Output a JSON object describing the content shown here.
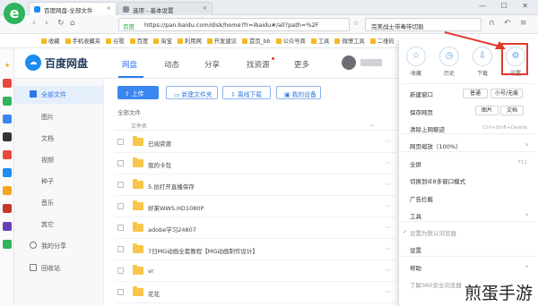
{
  "browser": {
    "logo": "e",
    "tabs": [
      {
        "label": "百度网盘-全部文件"
      },
      {
        "label": "选项 - 基本设置"
      }
    ],
    "address": {
      "secure_label": "百度",
      "url": "https://pan.baidu.com/disk/home?fr=ibaidu#/all?path=%2F"
    },
    "search": {
      "value": "完美战士带毒带切割"
    },
    "bookmarks": [
      "收藏",
      "手机收藏夹",
      "谷歌",
      "百度",
      "淘宝",
      "利用网",
      "开发建议",
      "首页_bb",
      "公众号商",
      "工具",
      "微博工具",
      "二维码"
    ]
  },
  "app": {
    "title": "百度网盘",
    "nav": [
      "网盘",
      "动态",
      "分享",
      "找资源",
      "更多"
    ]
  },
  "sidebar": {
    "items": [
      "全部文件",
      "图片",
      "文档",
      "视频",
      "种子",
      "音乐",
      "其它",
      "我的分享",
      "回收站"
    ]
  },
  "toolbar": {
    "upload": "上传",
    "new_folder": "新建文件夹",
    "offline": "离线下载",
    "my_devices": "我的设备"
  },
  "breadcrumb": "全部文件",
  "list": {
    "col_name": "文件名",
    "files": [
      "已阅资源",
      "我的卡包",
      "5.创打开直播保存",
      "好莱WWS.HD1080P",
      "adobe学习24807",
      "7日MG动画全套教程【MG动画制作设计】",
      "vr",
      "花花"
    ]
  },
  "menu": {
    "top": [
      {
        "icon": "star-icon",
        "label": "收藏"
      },
      {
        "icon": "history-icon",
        "label": "历史"
      },
      {
        "icon": "download-icon",
        "label": "下载"
      },
      {
        "icon": "gear-icon",
        "label": "设置"
      }
    ],
    "items": [
      {
        "label": "新建窗口"
      },
      {
        "label": "保存网页"
      },
      {
        "label": "清除上网痕迹",
        "key": "Ctrl+Shift+Delete"
      },
      {
        "label": "网页缩放（100%）"
      },
      {
        "label": "全屏",
        "key": "F11"
      },
      {
        "label": "切换到IE8多窗口模式"
      },
      {
        "label": "广告拦截"
      },
      {
        "label": "工具"
      },
      {
        "label": "设置为默认浏览器"
      },
      {
        "label": "设置"
      },
      {
        "label": "帮助"
      },
      {
        "label": "了解360安全浏览器"
      }
    ],
    "window_opts": [
      "普通",
      "小号/无痕"
    ],
    "save_opts": [
      "图片",
      "文档"
    ]
  },
  "watermark": "煎蛋手游",
  "colors": {
    "accent": "#2a78e6",
    "highlight": "#e13a2e",
    "brand": "#2fb35b"
  }
}
